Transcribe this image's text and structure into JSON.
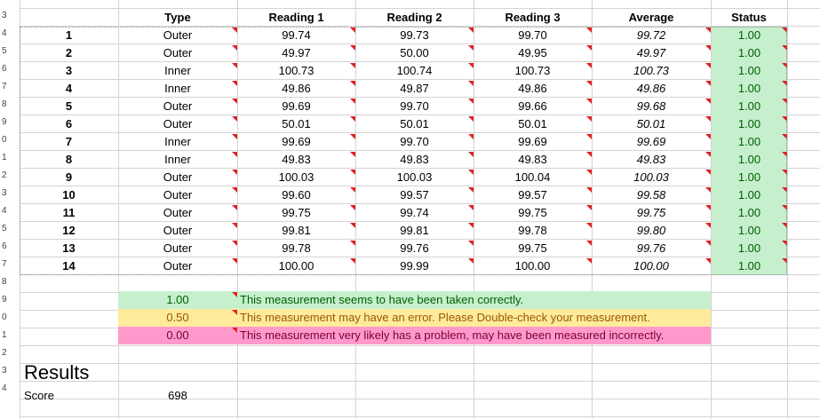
{
  "headers": {
    "type": "Type",
    "reading1": "Reading 1",
    "reading2": "Reading 2",
    "reading3": "Reading 3",
    "average": "Average",
    "status": "Status"
  },
  "row_numbers": [
    "3",
    "4",
    "5",
    "6",
    "7",
    "8",
    "9",
    "0",
    "1",
    "2",
    "3",
    "4",
    "5",
    "6",
    "7",
    "8",
    "9",
    "0",
    "1",
    "2",
    "3",
    "4"
  ],
  "rows": [
    {
      "id": "1",
      "type": "Outer",
      "r1": "99.74",
      "r2": "99.73",
      "r3": "99.70",
      "avg": "99.72",
      "status": "1.00"
    },
    {
      "id": "2",
      "type": "Outer",
      "r1": "49.97",
      "r2": "50.00",
      "r3": "49.95",
      "avg": "49.97",
      "status": "1.00"
    },
    {
      "id": "3",
      "type": "Inner",
      "r1": "100.73",
      "r2": "100.74",
      "r3": "100.73",
      "avg": "100.73",
      "status": "1.00"
    },
    {
      "id": "4",
      "type": "Inner",
      "r1": "49.86",
      "r2": "49.87",
      "r3": "49.86",
      "avg": "49.86",
      "status": "1.00"
    },
    {
      "id": "5",
      "type": "Outer",
      "r1": "99.69",
      "r2": "99.70",
      "r3": "99.66",
      "avg": "99.68",
      "status": "1.00"
    },
    {
      "id": "6",
      "type": "Outer",
      "r1": "50.01",
      "r2": "50.01",
      "r3": "50.01",
      "avg": "50.01",
      "status": "1.00"
    },
    {
      "id": "7",
      "type": "Inner",
      "r1": "99.69",
      "r2": "99.70",
      "r3": "99.69",
      "avg": "99.69",
      "status": "1.00"
    },
    {
      "id": "8",
      "type": "Inner",
      "r1": "49.83",
      "r2": "49.83",
      "r3": "49.83",
      "avg": "49.83",
      "status": "1.00"
    },
    {
      "id": "9",
      "type": "Outer",
      "r1": "100.03",
      "r2": "100.03",
      "r3": "100.04",
      "avg": "100.03",
      "status": "1.00"
    },
    {
      "id": "10",
      "type": "Outer",
      "r1": "99.60",
      "r2": "99.57",
      "r3": "99.57",
      "avg": "99.58",
      "status": "1.00"
    },
    {
      "id": "11",
      "type": "Outer",
      "r1": "99.75",
      "r2": "99.74",
      "r3": "99.75",
      "avg": "99.75",
      "status": "1.00"
    },
    {
      "id": "12",
      "type": "Outer",
      "r1": "99.81",
      "r2": "99.81",
      "r3": "99.78",
      "avg": "99.80",
      "status": "1.00"
    },
    {
      "id": "13",
      "type": "Outer",
      "r1": "99.78",
      "r2": "99.76",
      "r3": "99.75",
      "avg": "99.76",
      "status": "1.00"
    },
    {
      "id": "14",
      "type": "Outer",
      "r1": "100.00",
      "r2": "99.99",
      "r3": "100.00",
      "avg": "100.00",
      "status": "1.00"
    }
  ],
  "legend": [
    {
      "value": "1.00",
      "text": "This measurement seems to have been taken correctly.",
      "fill": "#c6efce",
      "color": "#006100"
    },
    {
      "value": "0.50",
      "text": "This measurement may have an error. Please Double-check your measurement.",
      "fill": "#ffeb9c",
      "color": "#9c5700"
    },
    {
      "value": "0.00",
      "text": "This measurement very likely has a problem, may have been measured incorrectly.",
      "fill": "#ff99cc",
      "color": "#7a0033"
    }
  ],
  "results": {
    "title": "Results",
    "score_label": "Score",
    "score_value": "698"
  },
  "colors": {
    "comment_marker": "#e02020",
    "gridline": "#d4d4d4"
  },
  "icons": {
    "comment_marker": "comment-indicator-icon"
  }
}
